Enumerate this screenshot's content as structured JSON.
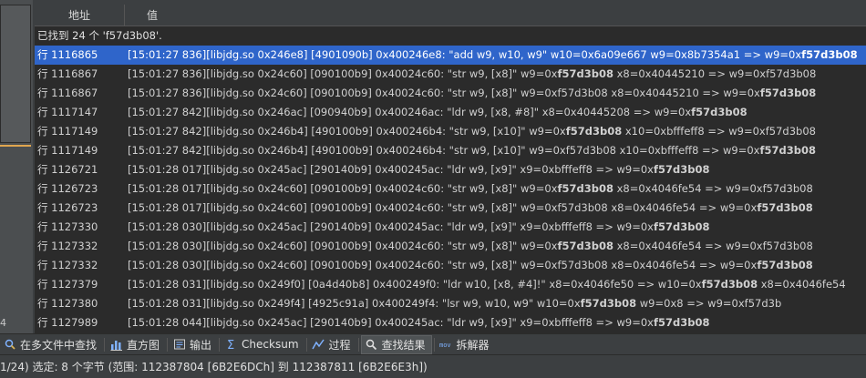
{
  "header": {
    "col_address": "地址",
    "col_value": "值"
  },
  "summary": "已找到 24 个 'f57d3b08'.",
  "rows": [
    {
      "line": "行 1116865",
      "pre": "[15:01:27 836][libjdg.so 0x246e8] [4901090b] 0x400246e8: \"add w9, w10, w9\" w10=0x6a09e667 w9=0x8b7354a1 => w9=0x",
      "hl": "f57d3b08",
      "post": "",
      "selected": true
    },
    {
      "line": "行 1116867",
      "pre": "[15:01:27 836][libjdg.so 0x24c60] [090100b9] 0x40024c60: \"str w9, [x8]\" w9=0x",
      "hl": "f57d3b08",
      "post": " x8=0x40445210 => w9=0xf57d3b08"
    },
    {
      "line": "行 1116867",
      "pre": "[15:01:27 836][libjdg.so 0x24c60] [090100b9] 0x40024c60: \"str w9, [x8]\" w9=0xf57d3b08 x8=0x40445210 => w9=0x",
      "hl": "f57d3b08",
      "post": ""
    },
    {
      "line": "行 1117147",
      "pre": "[15:01:27 842][libjdg.so 0x246ac] [090940b9] 0x400246ac: \"ldr w9, [x8, #8]\" x8=0x40445208 => w9=0x",
      "hl": "f57d3b08",
      "post": ""
    },
    {
      "line": "行 1117149",
      "pre": "[15:01:27 842][libjdg.so 0x246b4] [490100b9] 0x400246b4: \"str w9, [x10]\" w9=0x",
      "hl": "f57d3b08",
      "post": " x10=0xbfffeff8 => w9=0xf57d3b08"
    },
    {
      "line": "行 1117149",
      "pre": "[15:01:27 842][libjdg.so 0x246b4] [490100b9] 0x400246b4: \"str w9, [x10]\" w9=0xf57d3b08 x10=0xbfffeff8 => w9=0x",
      "hl": "f57d3b08",
      "post": ""
    },
    {
      "line": "行 1126721",
      "pre": "[15:01:28 017][libjdg.so 0x245ac] [290140b9] 0x400245ac: \"ldr w9, [x9]\" x9=0xbfffeff8 => w9=0x",
      "hl": "f57d3b08",
      "post": ""
    },
    {
      "line": "行 1126723",
      "pre": "[15:01:28 017][libjdg.so 0x24c60] [090100b9] 0x40024c60: \"str w9, [x8]\" w9=0x",
      "hl": "f57d3b08",
      "post": " x8=0x4046fe54 => w9=0xf57d3b08"
    },
    {
      "line": "行 1126723",
      "pre": "[15:01:28 017][libjdg.so 0x24c60] [090100b9] 0x40024c60: \"str w9, [x8]\" w9=0xf57d3b08 x8=0x4046fe54 => w9=0x",
      "hl": "f57d3b08",
      "post": ""
    },
    {
      "line": "行 1127330",
      "pre": "[15:01:28 030][libjdg.so 0x245ac] [290140b9] 0x400245ac: \"ldr w9, [x9]\" x9=0xbfffeff8 => w9=0x",
      "hl": "f57d3b08",
      "post": ""
    },
    {
      "line": "行 1127332",
      "pre": "[15:01:28 030][libjdg.so 0x24c60] [090100b9] 0x40024c60: \"str w9, [x8]\" w9=0x",
      "hl": "f57d3b08",
      "post": " x8=0x4046fe54 => w9=0xf57d3b08"
    },
    {
      "line": "行 1127332",
      "pre": "[15:01:28 030][libjdg.so 0x24c60] [090100b9] 0x40024c60: \"str w9, [x8]\" w9=0xf57d3b08 x8=0x4046fe54 => w9=0x",
      "hl": "f57d3b08",
      "post": ""
    },
    {
      "line": "行 1127379",
      "pre": "[15:01:28 031][libjdg.so 0x249f0] [0a4d40b8] 0x400249f0: \"ldr w10, [x8, #4]!\" x8=0x4046fe50 => w10=0x",
      "hl": "f57d3b08",
      "post": " x8=0x4046fe54"
    },
    {
      "line": "行 1127380",
      "pre": "[15:01:28 031][libjdg.so 0x249f4] [4925c91a] 0x400249f4: \"lsr w9, w10, w9\" w10=0x",
      "hl": "f57d3b08",
      "post": " w9=0x8 => w9=0xf57d3b"
    },
    {
      "line": "行 1127989",
      "pre": "[15:01:28 044][libjdg.so 0x245ac] [290140b9] 0x400245ac: \"ldr w9, [x9]\" x9=0xbfffeff8 => w9=0x",
      "hl": "f57d3b08",
      "post": ""
    }
  ],
  "left_strip": {
    "digit": "4"
  },
  "toolbar": {
    "tabs": [
      {
        "label": "在多文件中查找",
        "icon": "find-in-files-icon",
        "active": false
      },
      {
        "label": "直方图",
        "icon": "histogram-icon",
        "active": false
      },
      {
        "label": "输出",
        "icon": "output-icon",
        "active": false
      },
      {
        "label": "Checksum",
        "icon": "checksum-icon",
        "active": false
      },
      {
        "label": "过程",
        "icon": "process-icon",
        "active": false
      },
      {
        "label": "查找结果",
        "icon": "search-results-icon",
        "active": true
      },
      {
        "label": "拆解器",
        "icon": "disassembler-icon",
        "active": false
      }
    ]
  },
  "status": "1/24) 选定: 8 个字节 (范围: 112387804 [6B2E6DCh] 到 112387811 [6B2E6E3h])",
  "colors": {
    "selection": "#2f65ca",
    "background": "#2b2b2b",
    "chrome": "#3c3f41",
    "accent": "#e0a64f"
  }
}
